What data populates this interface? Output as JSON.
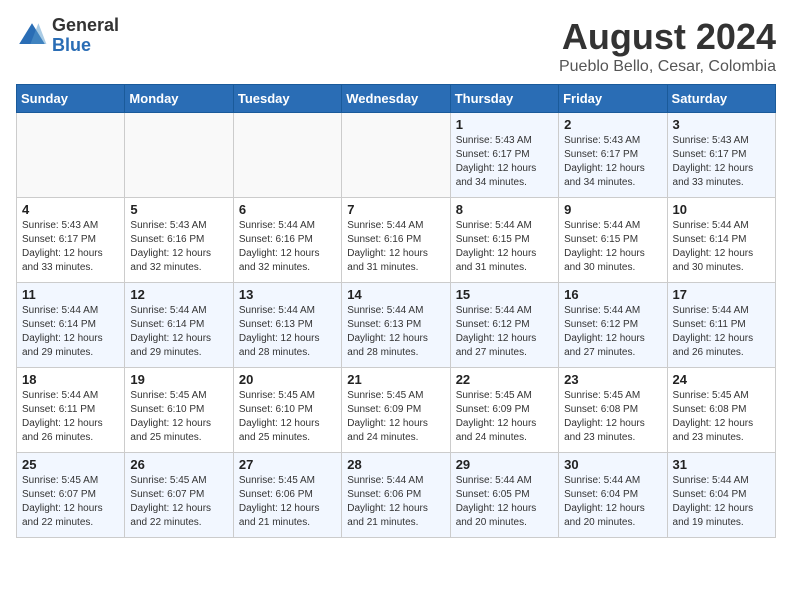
{
  "logo": {
    "general": "General",
    "blue": "Blue"
  },
  "title": "August 2024",
  "subtitle": "Pueblo Bello, Cesar, Colombia",
  "days_of_week": [
    "Sunday",
    "Monday",
    "Tuesday",
    "Wednesday",
    "Thursday",
    "Friday",
    "Saturday"
  ],
  "weeks": [
    [
      {
        "day": "",
        "info": ""
      },
      {
        "day": "",
        "info": ""
      },
      {
        "day": "",
        "info": ""
      },
      {
        "day": "",
        "info": ""
      },
      {
        "day": "1",
        "info": "Sunrise: 5:43 AM\nSunset: 6:17 PM\nDaylight: 12 hours\nand 34 minutes."
      },
      {
        "day": "2",
        "info": "Sunrise: 5:43 AM\nSunset: 6:17 PM\nDaylight: 12 hours\nand 34 minutes."
      },
      {
        "day": "3",
        "info": "Sunrise: 5:43 AM\nSunset: 6:17 PM\nDaylight: 12 hours\nand 33 minutes."
      }
    ],
    [
      {
        "day": "4",
        "info": "Sunrise: 5:43 AM\nSunset: 6:17 PM\nDaylight: 12 hours\nand 33 minutes."
      },
      {
        "day": "5",
        "info": "Sunrise: 5:43 AM\nSunset: 6:16 PM\nDaylight: 12 hours\nand 32 minutes."
      },
      {
        "day": "6",
        "info": "Sunrise: 5:44 AM\nSunset: 6:16 PM\nDaylight: 12 hours\nand 32 minutes."
      },
      {
        "day": "7",
        "info": "Sunrise: 5:44 AM\nSunset: 6:16 PM\nDaylight: 12 hours\nand 31 minutes."
      },
      {
        "day": "8",
        "info": "Sunrise: 5:44 AM\nSunset: 6:15 PM\nDaylight: 12 hours\nand 31 minutes."
      },
      {
        "day": "9",
        "info": "Sunrise: 5:44 AM\nSunset: 6:15 PM\nDaylight: 12 hours\nand 30 minutes."
      },
      {
        "day": "10",
        "info": "Sunrise: 5:44 AM\nSunset: 6:14 PM\nDaylight: 12 hours\nand 30 minutes."
      }
    ],
    [
      {
        "day": "11",
        "info": "Sunrise: 5:44 AM\nSunset: 6:14 PM\nDaylight: 12 hours\nand 29 minutes."
      },
      {
        "day": "12",
        "info": "Sunrise: 5:44 AM\nSunset: 6:14 PM\nDaylight: 12 hours\nand 29 minutes."
      },
      {
        "day": "13",
        "info": "Sunrise: 5:44 AM\nSunset: 6:13 PM\nDaylight: 12 hours\nand 28 minutes."
      },
      {
        "day": "14",
        "info": "Sunrise: 5:44 AM\nSunset: 6:13 PM\nDaylight: 12 hours\nand 28 minutes."
      },
      {
        "day": "15",
        "info": "Sunrise: 5:44 AM\nSunset: 6:12 PM\nDaylight: 12 hours\nand 27 minutes."
      },
      {
        "day": "16",
        "info": "Sunrise: 5:44 AM\nSunset: 6:12 PM\nDaylight: 12 hours\nand 27 minutes."
      },
      {
        "day": "17",
        "info": "Sunrise: 5:44 AM\nSunset: 6:11 PM\nDaylight: 12 hours\nand 26 minutes."
      }
    ],
    [
      {
        "day": "18",
        "info": "Sunrise: 5:44 AM\nSunset: 6:11 PM\nDaylight: 12 hours\nand 26 minutes."
      },
      {
        "day": "19",
        "info": "Sunrise: 5:45 AM\nSunset: 6:10 PM\nDaylight: 12 hours\nand 25 minutes."
      },
      {
        "day": "20",
        "info": "Sunrise: 5:45 AM\nSunset: 6:10 PM\nDaylight: 12 hours\nand 25 minutes."
      },
      {
        "day": "21",
        "info": "Sunrise: 5:45 AM\nSunset: 6:09 PM\nDaylight: 12 hours\nand 24 minutes."
      },
      {
        "day": "22",
        "info": "Sunrise: 5:45 AM\nSunset: 6:09 PM\nDaylight: 12 hours\nand 24 minutes."
      },
      {
        "day": "23",
        "info": "Sunrise: 5:45 AM\nSunset: 6:08 PM\nDaylight: 12 hours\nand 23 minutes."
      },
      {
        "day": "24",
        "info": "Sunrise: 5:45 AM\nSunset: 6:08 PM\nDaylight: 12 hours\nand 23 minutes."
      }
    ],
    [
      {
        "day": "25",
        "info": "Sunrise: 5:45 AM\nSunset: 6:07 PM\nDaylight: 12 hours\nand 22 minutes."
      },
      {
        "day": "26",
        "info": "Sunrise: 5:45 AM\nSunset: 6:07 PM\nDaylight: 12 hours\nand 22 minutes."
      },
      {
        "day": "27",
        "info": "Sunrise: 5:45 AM\nSunset: 6:06 PM\nDaylight: 12 hours\nand 21 minutes."
      },
      {
        "day": "28",
        "info": "Sunrise: 5:44 AM\nSunset: 6:06 PM\nDaylight: 12 hours\nand 21 minutes."
      },
      {
        "day": "29",
        "info": "Sunrise: 5:44 AM\nSunset: 6:05 PM\nDaylight: 12 hours\nand 20 minutes."
      },
      {
        "day": "30",
        "info": "Sunrise: 5:44 AM\nSunset: 6:04 PM\nDaylight: 12 hours\nand 20 minutes."
      },
      {
        "day": "31",
        "info": "Sunrise: 5:44 AM\nSunset: 6:04 PM\nDaylight: 12 hours\nand 19 minutes."
      }
    ]
  ]
}
